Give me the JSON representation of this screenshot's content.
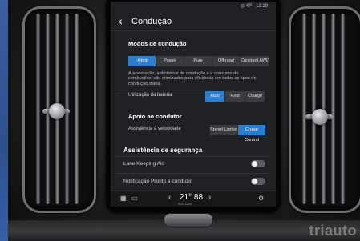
{
  "status_bar": {
    "left": "",
    "icons": "◎ 4P",
    "time": "12:19"
  },
  "header": {
    "back_glyph": "‹",
    "title": "Condução"
  },
  "driving_modes": {
    "title": "Modos de condução",
    "options": [
      "Hybrid",
      "Power",
      "Pure",
      "Off-road",
      "Constant AWD"
    ],
    "selected": "Hybrid",
    "description": "A aceleração, a dinâmica de condução e o consumo de combustível são otimizados para eficiência em todos os tipos de condução diária."
  },
  "battery": {
    "label": "Utilização da bateria",
    "options": [
      "Auto",
      "Hold",
      "Charge"
    ],
    "selected": "Auto"
  },
  "driver_support": {
    "title": "Apoio ao condutor",
    "speed_label": "Assistência à velocidade",
    "options": [
      "Speed Limiter",
      "Cruise Control"
    ],
    "selected": "Cruise Control"
  },
  "safety": {
    "title": "Assistência de segurança",
    "items": [
      {
        "label": "Lane Keeping Aid",
        "on": false
      },
      {
        "label": "Notificação Pronto a conduzir",
        "on": false
      }
    ]
  },
  "bottom_bar": {
    "temperature": "21° 88",
    "temperature_sub": "REDUZIDA",
    "left_arrow": "‹",
    "right_arrow": "›"
  },
  "watermark": "triauto",
  "colors": {
    "accent": "#2a7fd0",
    "screen_bg": "#202124"
  }
}
